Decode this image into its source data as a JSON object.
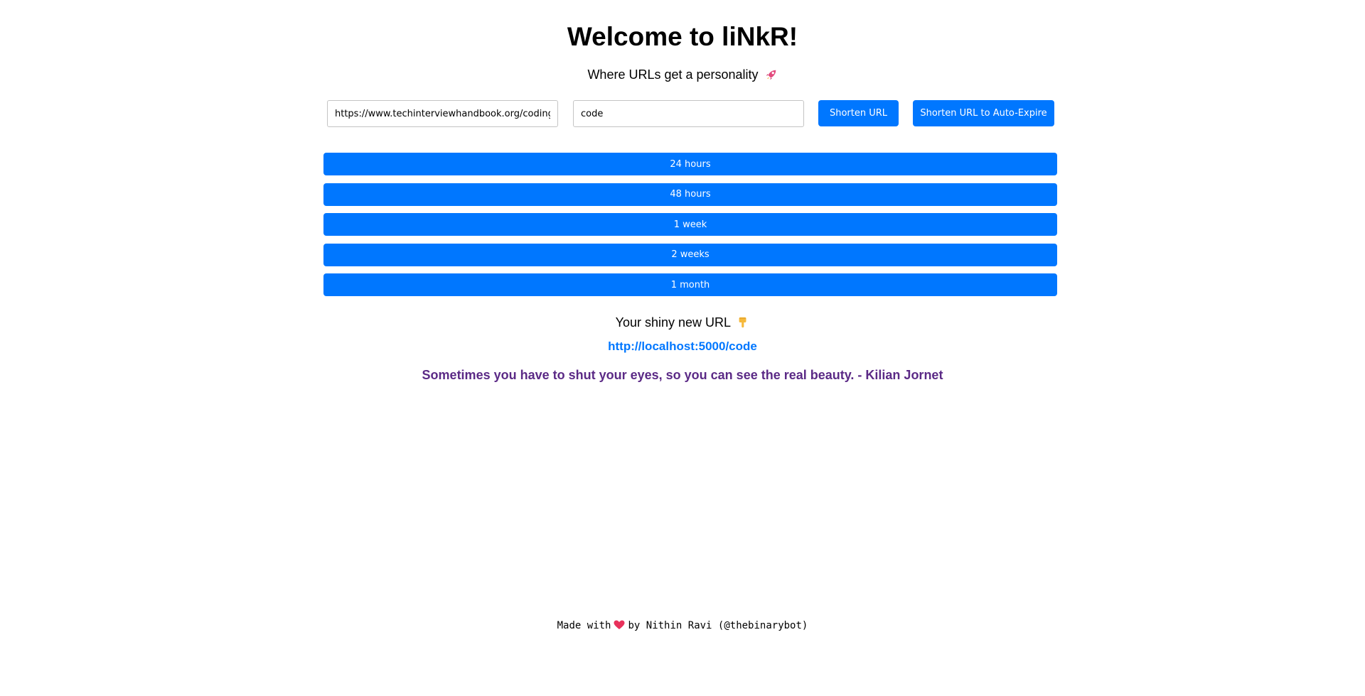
{
  "header": {
    "title": "Welcome to liNkR!",
    "subtitle": "Where URLs get a personality"
  },
  "form": {
    "url_value": "https://www.techinterviewhandbook.org/coding-inte",
    "alias_value": "code",
    "shorten_label": "Shorten URL",
    "expire_label": "Shorten URL to Auto-Expire"
  },
  "durations": [
    {
      "label": "24 hours"
    },
    {
      "label": "48 hours"
    },
    {
      "label": "1 week"
    },
    {
      "label": "2 weeks"
    },
    {
      "label": "1 month"
    }
  ],
  "result": {
    "label": "Your shiny new URL",
    "short_url": "http://localhost:5000/code"
  },
  "quote": "Sometimes you have to shut your eyes, so you can see the real beauty. - Kilian Jornet",
  "footer": {
    "prefix": "Made with",
    "suffix": "by Nithin Ravi (@thebinarybot)"
  },
  "colors": {
    "accent": "#0077ff",
    "quote": "#5b2a86",
    "heart": "#e8315b"
  },
  "icons": {
    "subtitle": "rocket-icon",
    "result": "pointing-down-hand-icon",
    "footer": "heart-icon"
  }
}
